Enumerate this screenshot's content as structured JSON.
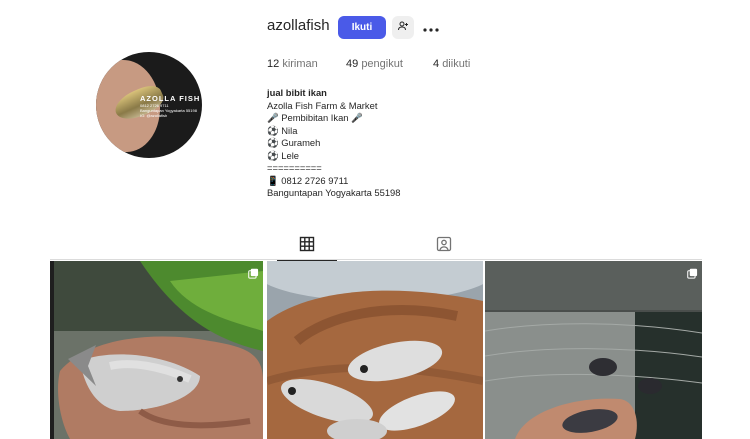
{
  "profile": {
    "username": "azollafish",
    "avatar": {
      "brand_title": "AZOLLA FISH",
      "brand_lines": [
        "0812 2726 9711",
        "Banguntapan Yogyakarta 55198",
        "IG: @azollafish"
      ]
    },
    "actions": {
      "follow_label": "Ikuti",
      "suggest_icon": "person-plus-icon",
      "more_icon": "more-options-icon"
    },
    "stats": {
      "posts": {
        "value": "12",
        "label": "kiriman"
      },
      "followers": {
        "value": "49",
        "label": "pengikut"
      },
      "following": {
        "value": "4",
        "label": "diikuti"
      }
    },
    "bio": {
      "name": "jual bibit ikan",
      "lines": [
        "Azolla Fish Farm & Market",
        "🎤 Pembibitan Ikan 🎤",
        "⚽ Nila",
        "⚽ Gurameh",
        "⚽ Lele",
        "==========",
        "📱 0812 2726 9711",
        "Banguntapan Yogyakarta 55198"
      ]
    }
  },
  "tabs": [
    {
      "name": "posts",
      "icon": "grid-icon",
      "active": true
    },
    {
      "name": "tagged",
      "icon": "tagged-icon",
      "active": false
    }
  ],
  "posts": [
    {
      "subject": "hand-holding-fish-grass",
      "multi": true,
      "multi_icon": "carousel-icon"
    },
    {
      "subject": "hand-holding-several-fish",
      "multi": false
    },
    {
      "subject": "hand-holding-fish-over-net",
      "multi": true,
      "multi_icon": "carousel-icon"
    }
  ],
  "colors": {
    "follow_button": "#4a5ae8",
    "text_primary": "#262626",
    "text_secondary": "#737373",
    "divider": "#dbdbdb"
  }
}
